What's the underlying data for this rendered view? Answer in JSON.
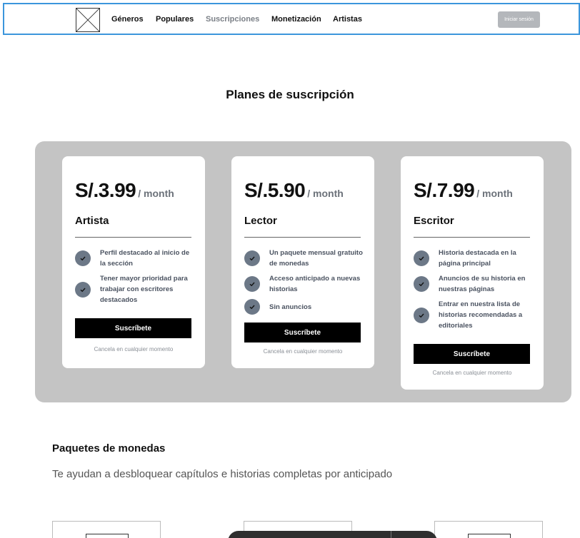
{
  "nav": {
    "logo_icon": "image-placeholder-icon",
    "links": [
      "Géneros",
      "Populares",
      "Suscripciones",
      "Monetización",
      "Artistas"
    ],
    "active_link": "Suscripciones",
    "login_label": "Iniciar sesión"
  },
  "subscriptions": {
    "title": "Planes de suscripción",
    "plans": [
      {
        "price": "S/.3.99",
        "period": "/ month",
        "name": "Artista",
        "features": [
          "Perfil destacado al inicio de la sección",
          "Tener mayor prioridad para trabajar con escritores destacados"
        ],
        "cta": "Suscríbete",
        "note": "Cancela en cualquier momento"
      },
      {
        "price": "S/.5.90",
        "period": "/ month",
        "name": "Lector",
        "features": [
          "Un paquete mensual gratuito de monedas",
          "Acceso anticipado a nuevas historias",
          "Sin anuncios"
        ],
        "cta": "Suscríbete",
        "note": "Cancela en cualquier momento"
      },
      {
        "price": "S/.7.99",
        "period": "/ month",
        "name": "Escritor",
        "features": [
          "Historia destacada en la página principal",
          "Anuncios de su historia en nuestras páginas",
          "Entrar en nuestra lista de historias recomendadas a editoriales"
        ],
        "cta": "Suscríbete",
        "note": "Cancela en cualquier momento"
      }
    ]
  },
  "coins": {
    "title": "Paquetes de monedas",
    "subtitle": "Te ayudan a desbloquear capítulos e historias completas por anticipado"
  },
  "colors": {
    "nav_border": "#3c96dc",
    "panel": "#c4c4c4",
    "check_bg": "#6c7887",
    "button": "#000000"
  }
}
